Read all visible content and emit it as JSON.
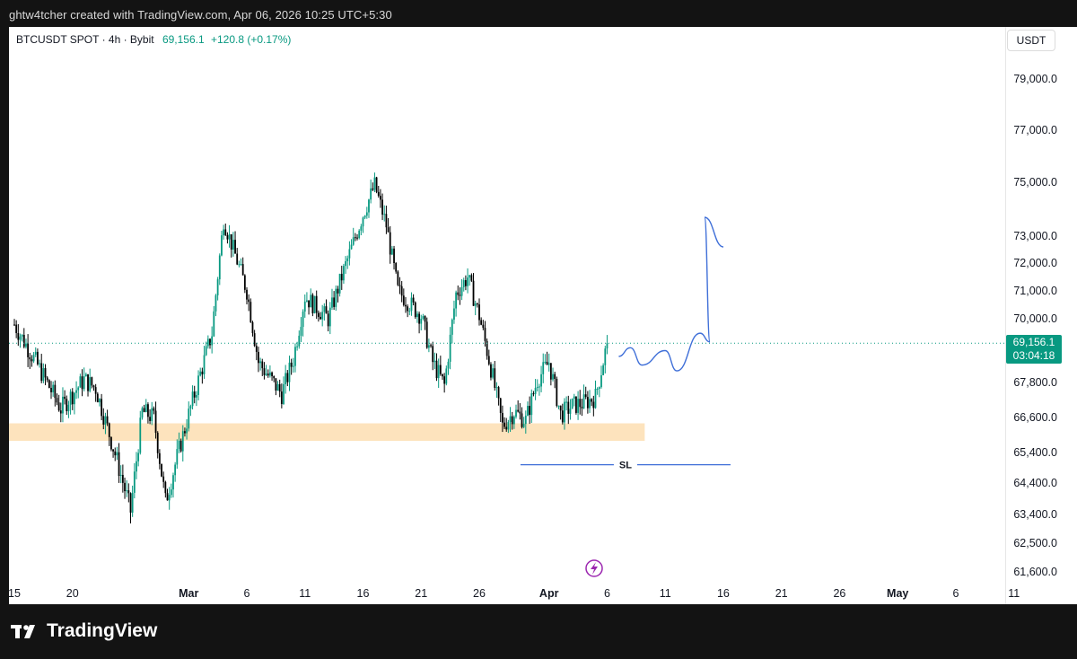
{
  "caption": "ghtw4tcher created with TradingView.com, Apr 06, 2026 10:25 UTC+5:30",
  "legend": {
    "symbol": "BTCUSDT SPOT · 4h · Bybit",
    "price": "69,156.1",
    "change": "+120.8 (+0.17%)"
  },
  "currency_button": "USDT",
  "price_tag": {
    "price": "69,156.1",
    "countdown": "03:04:18"
  },
  "sl_label": "SL",
  "footer": {
    "brand": "TradingView"
  },
  "colors": {
    "up": "#089981",
    "down": "#000000",
    "zone": "#fde3bd",
    "drawing": "#3f6fd8",
    "price_line": "#089981",
    "event_icon": "#9c27b0"
  },
  "chart_data": {
    "type": "candlestick",
    "timeframe": "4h",
    "last_price": 69156.1,
    "y_ticks": [
      "79,000.0",
      "77,000.0",
      "75,000.0",
      "73,000.0",
      "72,000.0",
      "71,000.0",
      "70,000.0",
      "67,800.0",
      "66,600.0",
      "65,400.0",
      "64,400.0",
      "63,400.0",
      "62,500.0",
      "61,600.0"
    ],
    "x_ticks": [
      "15",
      "20",
      "Mar",
      "6",
      "11",
      "16",
      "21",
      "26",
      "Apr",
      "6",
      "11",
      "16",
      "21",
      "26",
      "May",
      "6",
      "11"
    ],
    "x_major": [
      "Mar",
      "Apr",
      "May"
    ],
    "price_anchors": [
      {
        "date": "Feb 15",
        "close": 69800
      },
      {
        "date": "Feb 17",
        "close": 68400
      },
      {
        "date": "Feb 19",
        "close": 66900
      },
      {
        "date": "Feb 21",
        "close": 67900
      },
      {
        "date": "Feb 22",
        "close": 67600
      },
      {
        "date": "Feb 24",
        "close": 64900
      },
      {
        "date": "Feb 25",
        "close": 63500
      },
      {
        "date": "Feb 26",
        "close": 66800
      },
      {
        "date": "Feb 27",
        "close": 66600
      },
      {
        "date": "Feb 28",
        "close": 63800
      },
      {
        "date": "Mar 1",
        "close": 66700
      },
      {
        "date": "Mar 3",
        "close": 69500
      },
      {
        "date": "Mar 4",
        "close": 73600
      },
      {
        "date": "Mar 6",
        "close": 71000
      },
      {
        "date": "Mar 7",
        "close": 68500
      },
      {
        "date": "Mar 9",
        "close": 67400
      },
      {
        "date": "Mar 10",
        "close": 68600
      },
      {
        "date": "Mar 11",
        "close": 70800
      },
      {
        "date": "Mar 13",
        "close": 70000
      },
      {
        "date": "Mar 14",
        "close": 71300
      },
      {
        "date": "Mar 16",
        "close": 73800
      },
      {
        "date": "Mar 17",
        "close": 74900
      },
      {
        "date": "Mar 18",
        "close": 73400
      },
      {
        "date": "Mar 19",
        "close": 71000
      },
      {
        "date": "Mar 21",
        "close": 70100
      },
      {
        "date": "Mar 22",
        "close": 68500
      },
      {
        "date": "Mar 23",
        "close": 67700
      },
      {
        "date": "Mar 24",
        "close": 70900
      },
      {
        "date": "Mar 25",
        "close": 71500
      },
      {
        "date": "Mar 26",
        "close": 70100
      },
      {
        "date": "Mar 27",
        "close": 68300
      },
      {
        "date": "Mar 28",
        "close": 66300
      },
      {
        "date": "Mar 29",
        "close": 66800
      },
      {
        "date": "Mar 30",
        "close": 66500
      },
      {
        "date": "Mar 31",
        "close": 67900
      },
      {
        "date": "Apr 1",
        "close": 68500
      },
      {
        "date": "Apr 2",
        "close": 66700
      },
      {
        "date": "Apr 3",
        "close": 67000
      },
      {
        "date": "Apr 4",
        "close": 67100
      },
      {
        "date": "Apr 5",
        "close": 67300
      },
      {
        "date": "Apr 6",
        "close": 69156.1
      }
    ],
    "zone": {
      "from": 65800,
      "to": 66400,
      "start": "Feb 15",
      "end": "Apr 8"
    },
    "stop_loss": {
      "label": "SL",
      "price": 65000
    },
    "projection": [
      {
        "date": "Apr 7",
        "price": 68700
      },
      {
        "date": "Apr 8",
        "price": 69000
      },
      {
        "date": "Apr 9",
        "price": 68400
      },
      {
        "date": "Apr 11",
        "price": 68900
      },
      {
        "date": "Apr 12",
        "price": 68200
      },
      {
        "date": "Apr 14",
        "price": 69500
      },
      {
        "date": "Apr 15",
        "price": 69200
      },
      {
        "date": "Apr 15",
        "price": 73700
      },
      {
        "date": "Apr 16",
        "price": 72600
      }
    ]
  }
}
